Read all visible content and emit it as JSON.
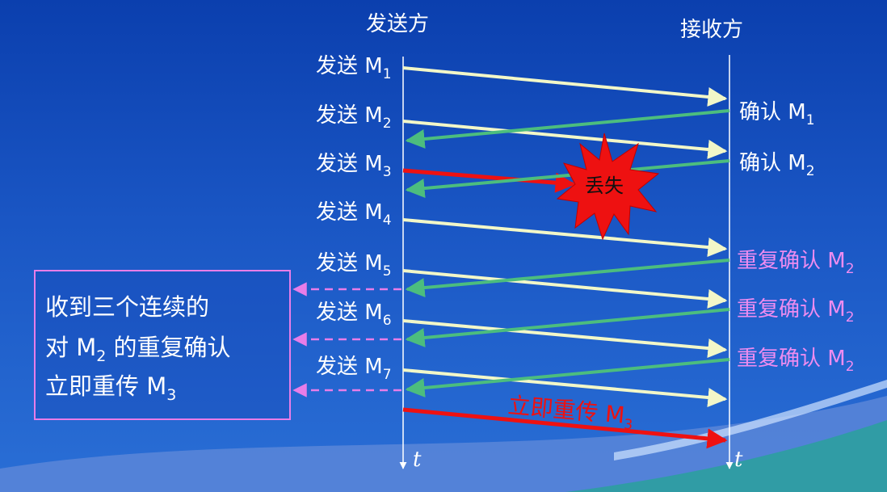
{
  "sender_title": "发送方",
  "receiver_title": "接收方",
  "send_labels": [
    {
      "prefix": "发送 M",
      "sub": "1"
    },
    {
      "prefix": "发送 M",
      "sub": "2"
    },
    {
      "prefix": "发送 M",
      "sub": "3"
    },
    {
      "prefix": "发送 M",
      "sub": "4"
    },
    {
      "prefix": "发送 M",
      "sub": "5"
    },
    {
      "prefix": "发送 M",
      "sub": "6"
    },
    {
      "prefix": "发送 M",
      "sub": "7"
    }
  ],
  "ack_labels": [
    {
      "prefix": "确认 M",
      "sub": "1",
      "color": "#ffffff"
    },
    {
      "prefix": "确认 M",
      "sub": "2",
      "color": "#ffffff"
    },
    {
      "prefix": "重复确认 M",
      "sub": "2",
      "color": "#ee8cf0"
    },
    {
      "prefix": "重复确认 M",
      "sub": "2",
      "color": "#ee8cf0"
    },
    {
      "prefix": "重复确认 M",
      "sub": "2",
      "color": "#ee8cf0"
    }
  ],
  "loss_label": "丢失",
  "retransmit_label": {
    "prefix": "立即重传 M",
    "sub": "3"
  },
  "note": {
    "line1": "收到三个连续的",
    "line2_prefix": "对 M",
    "line2_sub": "2",
    "line2_suffix": " 的重复确认",
    "line3_prefix": "立即重传 M",
    "line3_sub": "3"
  },
  "time_label": "t",
  "colors": {
    "data_arrow": "#f2f7c8",
    "ack_arrow": "#4cbd7e",
    "lost_arrow": "#ee1111",
    "retransmit_arrow": "#ee1111",
    "dup_ack_text": "#ee8cf0",
    "note_border": "#e87de8",
    "starburst": "#ee1111"
  }
}
